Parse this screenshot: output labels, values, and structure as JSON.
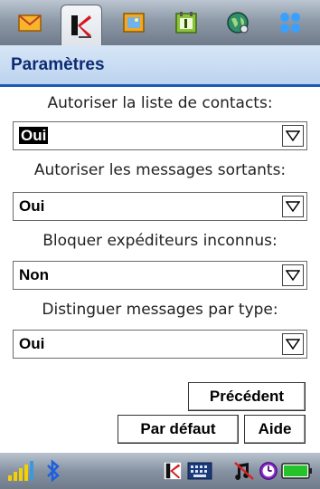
{
  "tabs": [
    {
      "name": "messages-tab",
      "icon": "envelope-icon",
      "active": false
    },
    {
      "name": "kaspersky-tab",
      "icon": "kaspersky-icon",
      "active": true
    },
    {
      "name": "photos-tab",
      "icon": "picture-icon",
      "active": false
    },
    {
      "name": "calendar-tab",
      "icon": "calendar-icon",
      "active": false
    },
    {
      "name": "web-tab",
      "icon": "globe-icon",
      "active": false
    },
    {
      "name": "apps-tab",
      "icon": "apps-grid-icon",
      "active": false
    }
  ],
  "page": {
    "title": "Paramètres"
  },
  "settings": [
    {
      "label": "Autoriser la liste de contacts:",
      "value": "Oui",
      "selected": true
    },
    {
      "label": "Autoriser les messages sortants:",
      "value": "Oui",
      "selected": false
    },
    {
      "label": "Bloquer expéditeurs inconnus:",
      "value": "Non",
      "selected": false
    },
    {
      "label": "Distinguer messages par type:",
      "value": "Oui",
      "selected": false
    }
  ],
  "buttons": {
    "previous": "Précédent",
    "default": "Par défaut",
    "help": "Aide"
  },
  "status": {
    "icons": [
      "signal-icon",
      "bluetooth-icon",
      "kaspersky-icon",
      "keyboard-icon",
      "silent-icon",
      "clock-icon",
      "battery-icon"
    ],
    "battery_level": 1.0
  },
  "colors": {
    "accent": "#1f57b8",
    "title_text": "#0c2b73"
  }
}
